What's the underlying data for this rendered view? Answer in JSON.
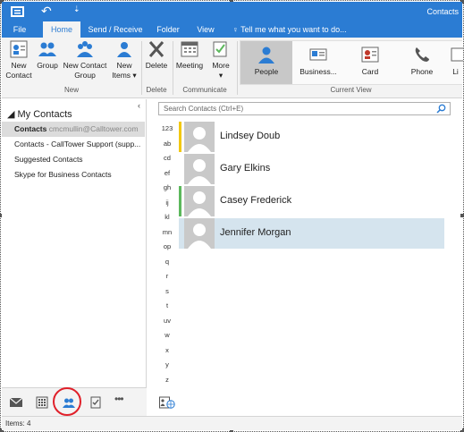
{
  "window": {
    "title": "Contacts"
  },
  "qat": {
    "more": "⇣"
  },
  "tabs": [
    {
      "label": "File"
    },
    {
      "label": "Home"
    },
    {
      "label": "Send / Receive"
    },
    {
      "label": "Folder"
    },
    {
      "label": "View"
    }
  ],
  "tell_me": "Tell me what you want to do...",
  "ribbon": {
    "new_group": {
      "label": "New",
      "new_contact": [
        "New",
        "Contact"
      ],
      "group": "Group",
      "new_contact_group": [
        "New Contact",
        "Group"
      ],
      "new_items": [
        "New",
        "Items ▾"
      ]
    },
    "delete_group": {
      "label": "Delete",
      "delete": "Delete"
    },
    "communicate_group": {
      "label": "Communicate",
      "meeting": "Meeting",
      "more": "More",
      "more_arrow": "▾"
    },
    "current_view": {
      "label": "Current View",
      "views": [
        {
          "label": "People"
        },
        {
          "label": "Business..."
        },
        {
          "label": "Card"
        },
        {
          "label": "Phone"
        },
        {
          "label": "Li"
        }
      ]
    }
  },
  "left_pane": {
    "collapse": "‹",
    "header": "◢ My Contacts",
    "folders": [
      {
        "label": "Contacts",
        "sub": "cmcmullin@Calltower.com"
      },
      {
        "label": "Contacts - CallTower Support (supp..."
      },
      {
        "label": "Suggested Contacts"
      },
      {
        "label": "Skype for Business Contacts"
      }
    ]
  },
  "navbar": {
    "more": "•••"
  },
  "search": {
    "placeholder": "Search Contacts (Ctrl+E)"
  },
  "alpha_index": [
    "123",
    "ab",
    "cd",
    "ef",
    "gh",
    "ij",
    "kl",
    "mn",
    "op",
    "q",
    "r",
    "s",
    "t",
    "uv",
    "w",
    "x",
    "y",
    "z"
  ],
  "contacts": [
    {
      "name": "Lindsey Doub",
      "bar_color": "#f2c811"
    },
    {
      "name": "Gary Elkins",
      "bar_color": "#ffffff"
    },
    {
      "name": "Casey Frederick",
      "bar_color": "#5cb85c"
    },
    {
      "name": "Jennifer Morgan",
      "bar_color": "#d5e4ee"
    }
  ],
  "status": {
    "items": "Items: 4"
  },
  "colors": {
    "accent": "#2b7cd3",
    "selection": "#d5e4ee",
    "highlight_ring": "#e0202a"
  }
}
